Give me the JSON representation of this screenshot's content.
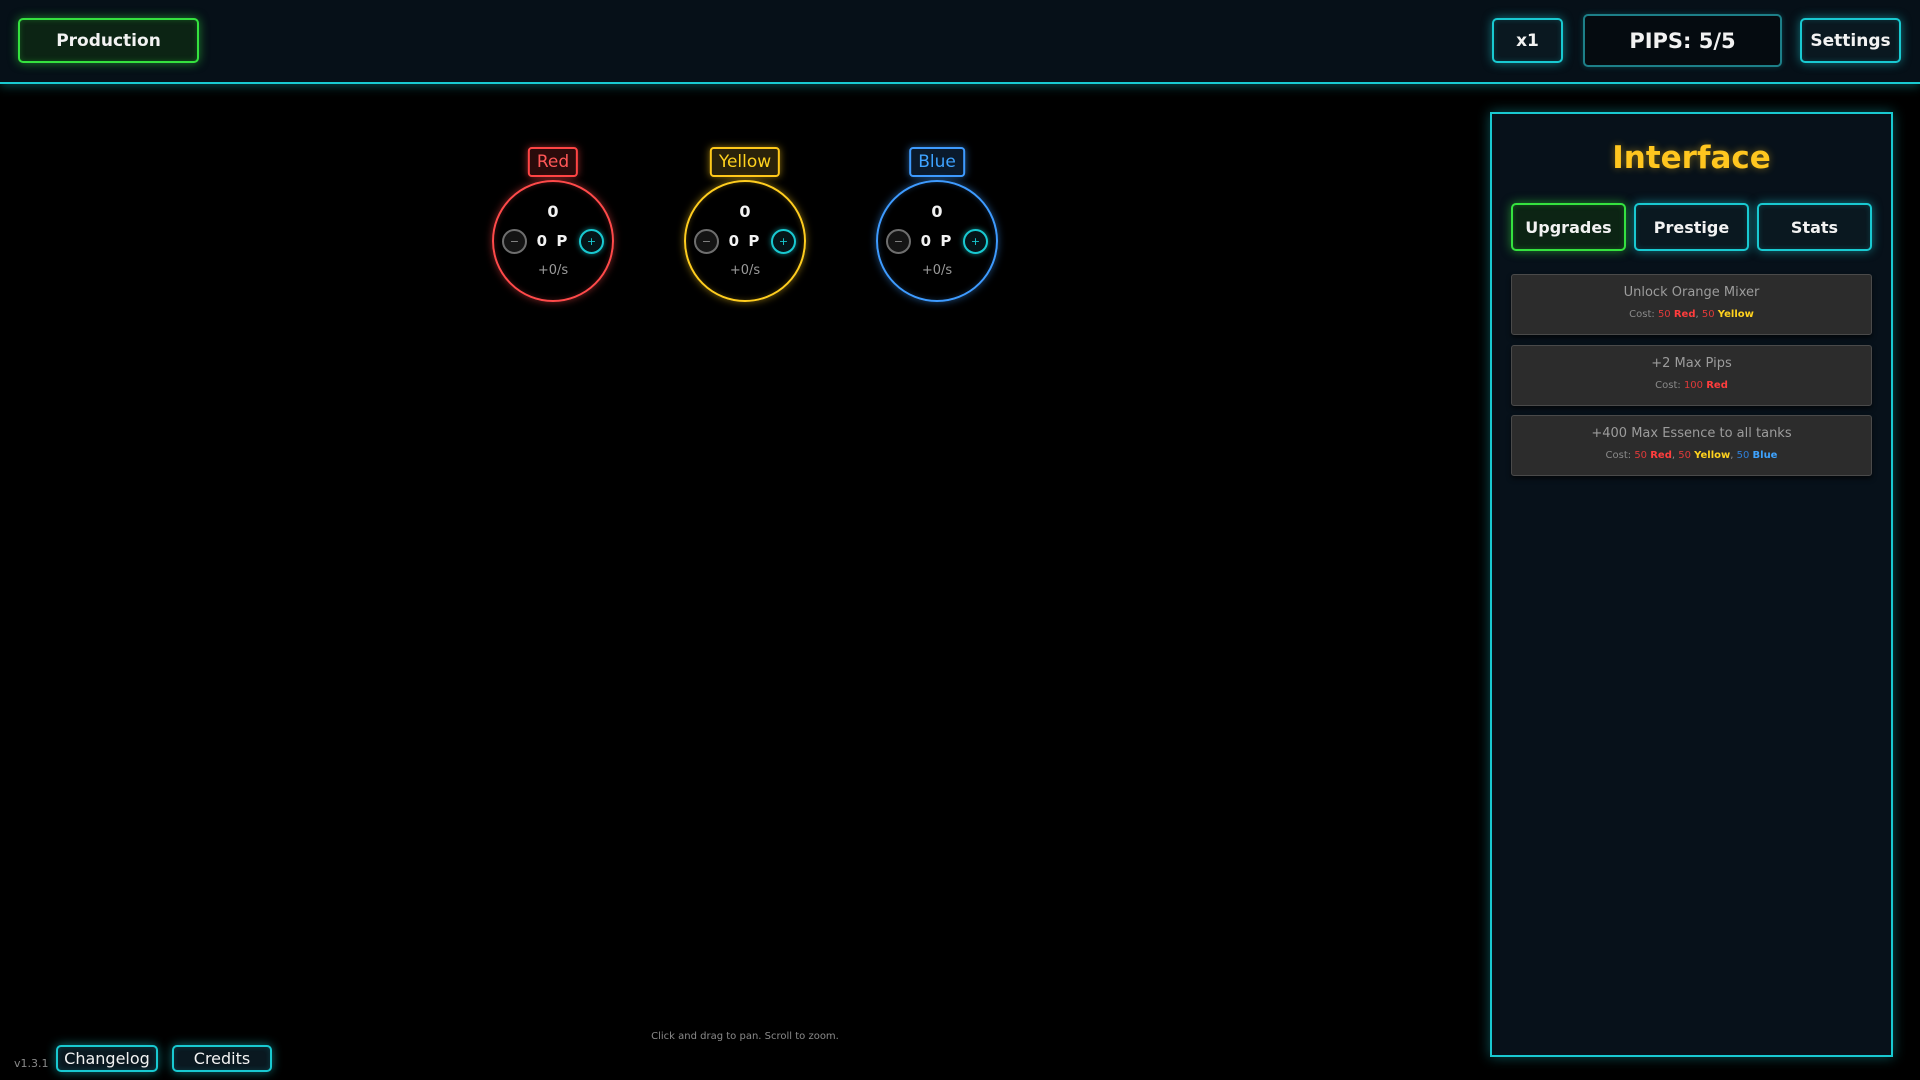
{
  "header": {
    "production_label": "Production",
    "multiplier_label": "x1",
    "pips_label": "PIPS: 5/5",
    "settings_label": "Settings"
  },
  "tanks": [
    {
      "name": "Red",
      "amount": "0",
      "pips": "0 P",
      "rate": "+0/s",
      "color": "#ff4a4a",
      "minus_icon": "minus-icon",
      "plus_icon": "plus-icon"
    },
    {
      "name": "Yellow",
      "amount": "0",
      "pips": "0 P",
      "rate": "+0/s",
      "color": "#ffcd1f",
      "minus_icon": "minus-icon",
      "plus_icon": "plus-icon"
    },
    {
      "name": "Blue",
      "amount": "0",
      "pips": "0 P",
      "rate": "+0/s",
      "color": "#3e9bff",
      "minus_icon": "minus-icon",
      "plus_icon": "plus-icon"
    }
  ],
  "panel": {
    "title": "Interface",
    "tabs": [
      "Upgrades",
      "Prestige",
      "Stats"
    ],
    "active_tab": "Upgrades",
    "upgrades": [
      {
        "name": "Unlock Orange Mixer",
        "cost_prefix": "Cost:",
        "costs": [
          {
            "amount": "50",
            "resource": "Red"
          },
          {
            "amount": "50",
            "resource": "Yellow"
          }
        ]
      },
      {
        "name": "+2 Max Pips",
        "cost_prefix": "Cost:",
        "costs": [
          {
            "amount": "100",
            "resource": "Red"
          }
        ]
      },
      {
        "name": "+400 Max Essence to all tanks",
        "cost_prefix": "Cost:",
        "costs": [
          {
            "amount": "50",
            "resource": "Red"
          },
          {
            "amount": "50",
            "resource": "Yellow"
          },
          {
            "amount": "50",
            "resource": "Blue"
          }
        ]
      }
    ]
  },
  "footer": {
    "version": "v1.3.1",
    "changelog_label": "Changelog",
    "credits_label": "Credits",
    "hint": "Click and drag to pan. Scroll to zoom."
  },
  "colors": {
    "accent_cyan": "#19c9d1",
    "accent_green": "#35e23f",
    "title_gold": "#ffc61f",
    "background": "#000000"
  }
}
